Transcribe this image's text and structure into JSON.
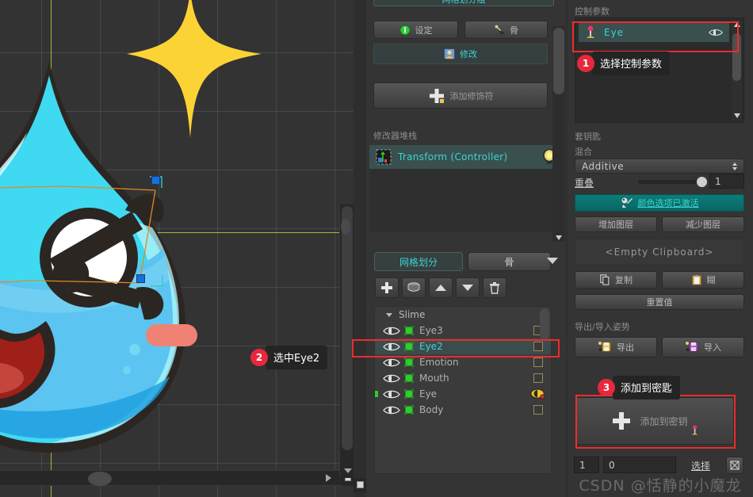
{
  "app": {
    "name": "live2d-style-rigging-editor"
  },
  "canvas": {
    "character": "slime-character",
    "sparkle": "yellow-four-point-star",
    "selection": "eye2-mesh-selection"
  },
  "middle_panel": {
    "top_truncated_tab": "网格划分组",
    "buttons": {
      "settings": "设定",
      "bone": "骨",
      "modify": "修改",
      "add_modifier": "添加修饰符"
    },
    "modifier_stack_label": "修改器堆栈",
    "modifier_stack_items": [
      {
        "name": "Transform (Controller)",
        "bulb": "lightbulb-icon"
      }
    ],
    "tabs": [
      {
        "label": "网格划分",
        "active": true
      },
      {
        "label": "骨",
        "active": false
      }
    ],
    "toolbar_icons": [
      "plus-icon",
      "disc-icon",
      "arrow-up-icon",
      "arrow-down-icon",
      "trash-icon"
    ],
    "tree": {
      "root": "Slime",
      "items": [
        {
          "label": "Eye3",
          "selected": false,
          "checked": false,
          "marked": false
        },
        {
          "label": "Eye2",
          "selected": true,
          "checked": false,
          "marked": false
        },
        {
          "label": "Emotion",
          "selected": false,
          "checked": false,
          "marked": false
        },
        {
          "label": "Mouth",
          "selected": false,
          "checked": false,
          "marked": false
        },
        {
          "label": "Eye",
          "selected": false,
          "checked": true,
          "marked": true
        },
        {
          "label": "Body",
          "selected": false,
          "checked": false,
          "marked": false
        }
      ]
    }
  },
  "right_panel": {
    "control_param_label": "控制参数",
    "parameters": [
      {
        "name": "Eye",
        "icon": "param-pin-icon",
        "eye_icon": "visibility-icon"
      }
    ],
    "keyset_label": "套钥匙",
    "blend_label": "混合",
    "blend_value": "Additive",
    "weight_label": "重叠",
    "weight_value": "1",
    "color_option_button": "颜色选项已激活",
    "add_layer_button": "增加图层",
    "remove_layer_button": "减少图层",
    "clipboard_text": "<Empty Clipboard>",
    "copy_button": "复制",
    "paste_button": "糊",
    "reset_button": "重置值",
    "export_import_label": "导出/导入姿势",
    "export_button": "导出",
    "import_button": "导入",
    "add_to_key_button": "添加到密钥",
    "bottom": {
      "field_a": "1",
      "field_b": "0",
      "select_label": "选择",
      "icon_button": "target-icon"
    }
  },
  "callouts": [
    {
      "id": "1",
      "text": "选择控制参数"
    },
    {
      "id": "2",
      "text": "选中Eye2"
    },
    {
      "id": "3",
      "text": "添加到密匙"
    }
  ],
  "watermark": "CSDN @恬静的小魔龙",
  "colors": {
    "accent_teal": "#3fd2d2",
    "highlight_red": "#ee2b2b",
    "panel_bg": "#343434",
    "canvas_bg": "#333333",
    "slime_body": "#3fd9f2",
    "slime_shadow": "#5bc4f0",
    "star_yellow": "#fcd335",
    "mouth_red": "#9e2019"
  }
}
